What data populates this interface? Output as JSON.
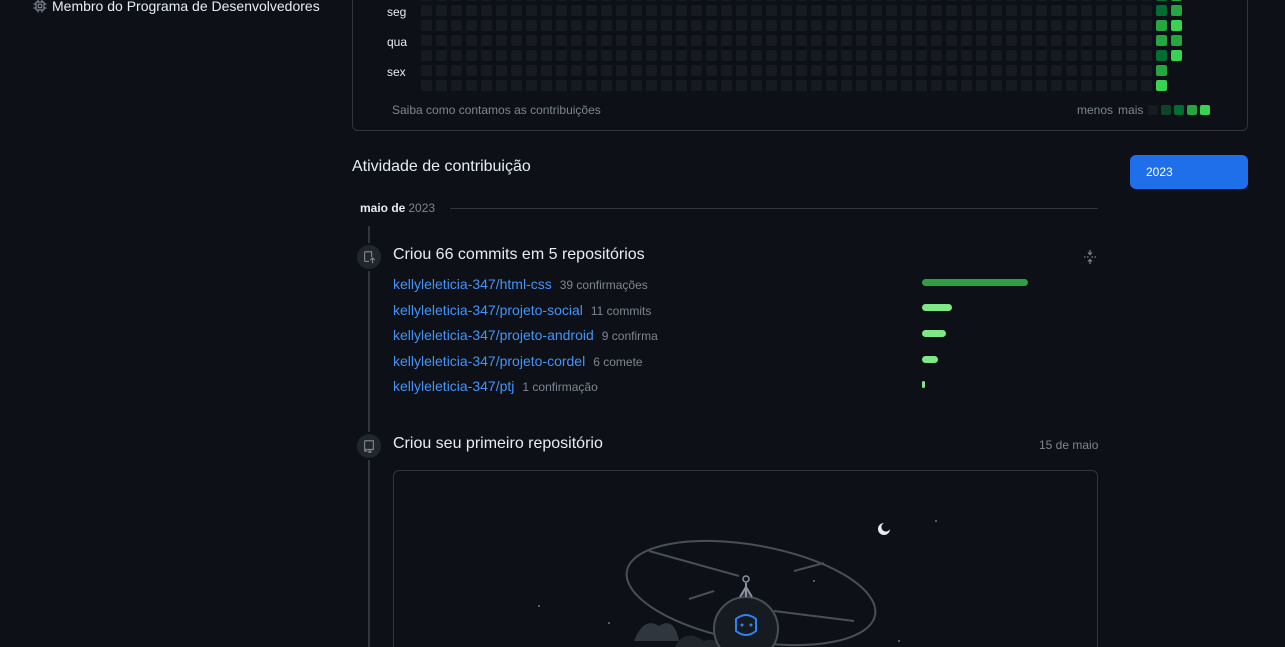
{
  "sidebar": {
    "developer_program_badge": "Membro do Programa de Desenvolvedores"
  },
  "contribution_graph": {
    "day_labels": [
      "seg",
      "qua",
      "sex"
    ],
    "footer_link": "Saiba como contamos as contribuições",
    "legend_less": "menos",
    "legend_more": "mais",
    "colors": {
      "empty": "#161b22",
      "level1": "#0e4429",
      "level2": "#006d32",
      "level3": "#26a641",
      "level4": "#39d353"
    }
  },
  "activity": {
    "title": "Atividade de contribuição",
    "year_button": "2023",
    "month": "maio de",
    "year": "2023",
    "commits_summary": "Criou 66 commits em 5 repositórios",
    "repos": [
      {
        "name": "kellyleleticia-347/html-css",
        "count": "39 confirmações",
        "commits": 39
      },
      {
        "name": "kellyleleticia-347/projeto-social",
        "count": "11 commits",
        "commits": 11
      },
      {
        "name": "kellyleleticia-347/projeto-android",
        "count": "9 confirma",
        "commits": 9
      },
      {
        "name": "kellyleleticia-347/projeto-cordel",
        "count": "6 comete",
        "commits": 6
      },
      {
        "name": "kellyleleticia-347/ptj",
        "count": "1 confirmação",
        "commits": 1
      }
    ],
    "first_repo_title": "Criou seu primeiro repositório",
    "first_repo_date": "15 de maio"
  }
}
